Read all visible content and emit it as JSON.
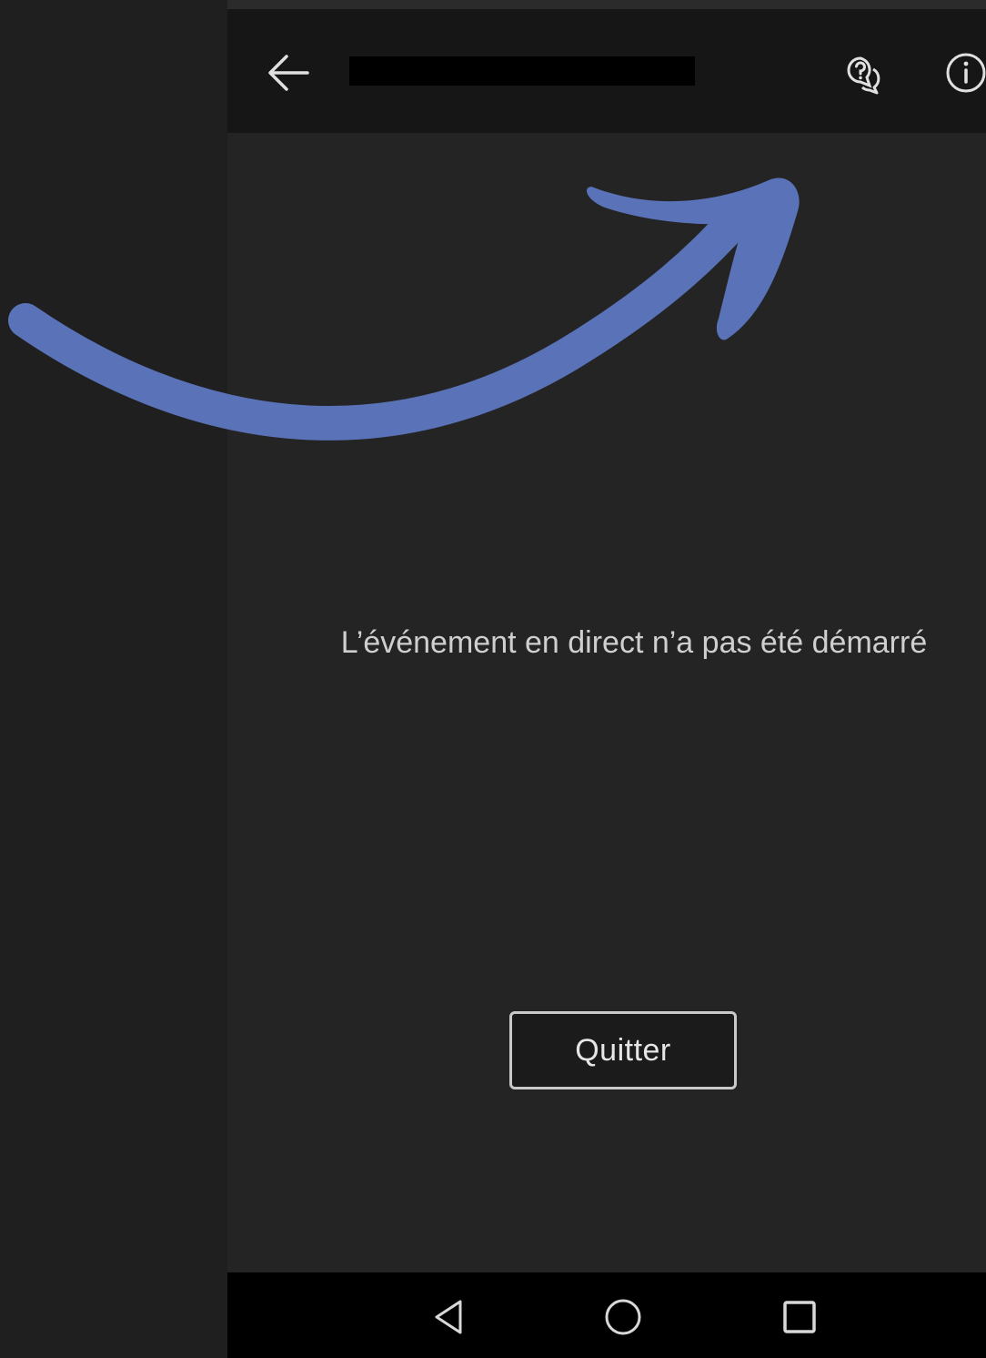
{
  "app_bar": {
    "title_redacted": true,
    "icons": {
      "back": "arrow-left-icon",
      "qa": "question-chat-icon",
      "info": "info-circle-icon"
    }
  },
  "main": {
    "status_message": "L’événement en direct n’a pas été démarré",
    "quit_label": "Quitter"
  },
  "nav_bar": {
    "icons": [
      "triangle-back-icon",
      "circle-home-icon",
      "square-recents-icon"
    ]
  },
  "annotation": {
    "arrow_color": "#5a72b8"
  },
  "colors": {
    "background": "#1f1f1f",
    "phone_surface": "#242424",
    "app_bar": "#161616",
    "text": "#cfcfcf"
  }
}
